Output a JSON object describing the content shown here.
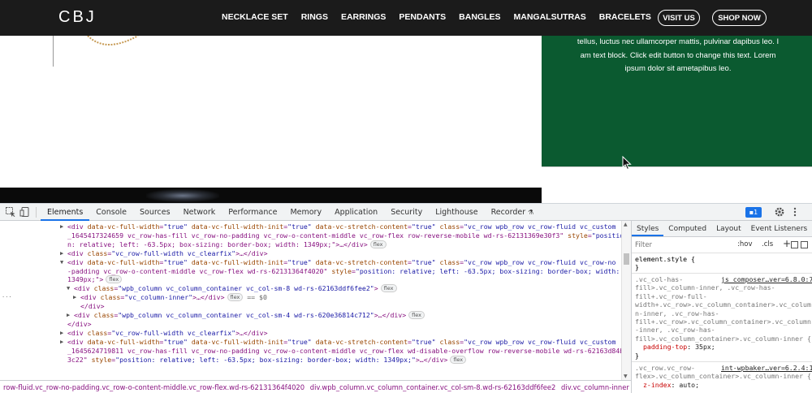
{
  "site": {
    "logo": "CBJ",
    "nav": [
      "NECKLACE SET",
      "RINGS",
      "EARRINGS",
      "PENDANTS",
      "BANGLES",
      "MANGALSUTRAS",
      "BRACELETS"
    ],
    "visit_label": "VISIT US",
    "shop_label": "SHOP NOW",
    "green_text_lines": [
      "tellus, luctus nec ullamcorper mattis, pulvinar dapibus leo. I",
      "am text block. Click edit button to change this text. Lorem",
      "ipsum dolor sit ametapibus leo."
    ],
    "colors": {
      "nav_bg": "#1b1b1b",
      "green_block": "#0b5a30"
    }
  },
  "devtools": {
    "tabs": [
      "Elements",
      "Console",
      "Sources",
      "Network",
      "Performance",
      "Memory",
      "Application",
      "Security",
      "Lighthouse",
      "Recorder"
    ],
    "active_tab": "Elements",
    "message_count": "1",
    "elements_lines": [
      {
        "indent": 0,
        "tri": "▶",
        "html": "<div data-vc-full-width=\"true\" data-vc-full-width-init=\"true\" data-vc-stretch-content=\"true\" class=\"vc_row wpb_row vc_row-fluid vc_custom"
      },
      {
        "indent": 1,
        "tri": "",
        "html": "_1645417324659 vc_row-has-fill vc_row-no-padding vc_row-o-content-middle vc_row-flex row-reverse-mobile wd-rs-62131369e30f3\" style=\"positio"
      },
      {
        "indent": 1,
        "tri": "",
        "html": "n: relative; left: -63.5px; box-sizing: border-box; width: 1349px;\">…</div>"
      },
      {
        "indent": 0,
        "tri": "▶",
        "html": "<div class=\"vc_row-full-width vc_clearfix\">…</div>"
      },
      {
        "indent": 0,
        "tri": "▼",
        "html": "<div data-vc-full-width=\"true\" data-vc-full-width-init=\"true\" data-vc-stretch-content=\"true\" class=\"vc_row wpb_row vc_row-fluid vc_row-no"
      },
      {
        "indent": 1,
        "tri": "",
        "html": "-padding vc_row-o-content-middle vc_row-flex wd-rs-62131364f4020\" style=\"position: relative; left: -63.5px; box-sizing: border-box; width:"
      },
      {
        "indent": 1,
        "tri": "",
        "html": "1349px;\">"
      },
      {
        "indent": 2,
        "tri": "▼",
        "html": "<div class=\"wpb_column vc_column_container vc_col-sm-8 wd-rs-62163ddf6fee2\">"
      },
      {
        "indent": 3,
        "tri": "▶",
        "html": "<div class=\"vc_column-inner\">…</div>"
      },
      {
        "indent": 3,
        "tri": "",
        "html": "</div>"
      },
      {
        "indent": 2,
        "tri": "▶",
        "html": "<div class=\"wpb_column vc_column_container vc_col-sm-4 wd-rs-620e36814c712\">…</div>"
      },
      {
        "indent": 1,
        "tri": "",
        "html": "</div>"
      },
      {
        "indent": 0,
        "tri": "▶",
        "html": "<div class=\"vc_row-full-width vc_clearfix\">…</div>"
      },
      {
        "indent": 0,
        "tri": "▶",
        "html": "<div data-vc-full-width=\"true\" data-vc-full-width-init=\"true\" data-vc-stretch-content=\"true\" class=\"vc_row wpb_row vc_row-fluid vc_custom"
      },
      {
        "indent": 1,
        "tri": "",
        "html": "_1645624719811 vc_row-has-fill vc_row-no-padding vc_row-o-content-middle vc_row-flex wd-disable-overflow row-reverse-mobile wd-rs-62163d84b"
      },
      {
        "indent": 1,
        "tri": "",
        "html": "3c22\" style=\"position: relative; left: -63.5px; box-sizing: border-box; width: 1349px;\">…</div>"
      }
    ],
    "selected_suffix": "== $0",
    "flex_label": "flex",
    "breadcrumbs": [
      "row-fluid.vc_row-no-padding.vc_row-o-content-middle.vc_row-flex.wd-rs-62131364f4020",
      "div.wpb_column.vc_column_container.vc_col-sm-8.wd-rs-62163ddf6fee2",
      "div.vc_column-inner"
    ],
    "styles_tabs": [
      "Styles",
      "Computed",
      "Layout",
      "Event Listeners",
      "»"
    ],
    "filter_placeholder": "Filter",
    "hov_label": ":hov",
    "cls_label": ".cls",
    "rules": {
      "element_style": "element.style {",
      "close": "}",
      "rule1_source": "js_composer…ver=6.8.0:7",
      "rule1_selectors": [
        ".vc_col-has-",
        "fill>.vc_column-inner, .vc_row-has-",
        "fill+.vc_row-full-",
        "width+.vc_row>.vc_column_container>.vc_colum",
        "n-inner, .vc_row-has-",
        "fill+.vc_row>.vc_column_container>.vc_column",
        "-inner, .vc_row-has-",
        "fill>.vc_column_container>.vc_column-inner {"
      ],
      "rule1_prop": "padding-top",
      "rule1_val": "35px;",
      "rule2_source": "int-wpbaker…ver=6.2.4:1",
      "rule2_selectors": [
        ".vc_row.vc_row-",
        "flex>.vc_column_container>.vc_column-inner {"
      ],
      "rule2_prop": "z-index",
      "rule2_val": "auto;"
    }
  }
}
